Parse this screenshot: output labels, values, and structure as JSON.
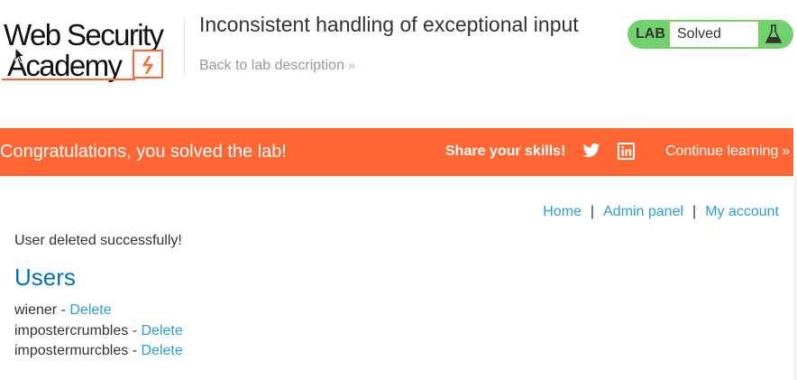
{
  "header": {
    "logo_line1": "Web Security",
    "logo_line2": "Academy",
    "lab_title": "Inconsistent handling of exceptional input",
    "back_link": "Back to lab description",
    "lab_badge": "LAB",
    "lab_status": "Solved"
  },
  "banner": {
    "message": "Congratulations, you solved the lab!",
    "share_label": "Share your skills!",
    "twitter_icon": "twitter-icon",
    "linkedin_icon": "linkedin-icon",
    "continue_label": "Continue learning"
  },
  "nav": {
    "home": "Home",
    "separator": "|",
    "admin": "Admin panel",
    "account": "My account"
  },
  "main": {
    "message": "User deleted successfully!",
    "heading": "Users",
    "users": [
      {
        "name": "wiener",
        "separator": " - ",
        "action": "Delete"
      },
      {
        "name": "impostercrumbles",
        "separator": " - ",
        "action": "Delete"
      },
      {
        "name": "impostermurcbles",
        "separator": " - ",
        "action": "Delete"
      }
    ]
  },
  "colors": {
    "banner": "#ff6633",
    "lab_badge": "#70d16d",
    "link": "#2a9fd6",
    "heading": "#0071bc"
  }
}
